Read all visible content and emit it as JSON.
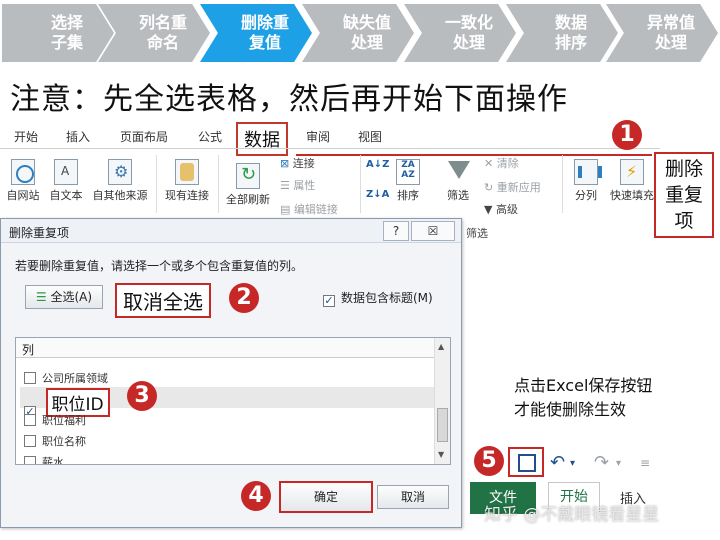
{
  "steps": [
    "选择\n子集",
    "列名重\n命名",
    "删除重\n复值",
    "缺失值\n处理",
    "一致化\n处理",
    "数据\n排序",
    "异常值\n处理"
  ],
  "steps_split": [
    [
      "选择",
      "子集"
    ],
    [
      "列名重",
      "命名"
    ],
    [
      "删除重",
      "复值"
    ],
    [
      "缺失值",
      "处理"
    ],
    [
      "一致化",
      "处理"
    ],
    [
      "数据",
      "排序"
    ],
    [
      "异常值",
      "处理"
    ]
  ],
  "active_step_index": 2,
  "heading": "注意：先全选表格，然后再开始下面操作",
  "ribbon": {
    "tabs": [
      "开始",
      "插入",
      "页面布局",
      "公式",
      "数据",
      "审阅",
      "视图"
    ],
    "active_tab": "数据",
    "buttons": {
      "from_web": "自网站",
      "from_text": "自文本",
      "from_other": "自其他来源",
      "existing_conn": "现有连接",
      "refresh_all": "全部刷新",
      "connections": "连接",
      "properties": "属性",
      "edit_links": "编辑链接",
      "sort": "排序",
      "filter": "筛选",
      "clear": "清除",
      "reapply": "重新应用",
      "advanced": "高级",
      "filter_group": "筛选",
      "split_cols": "分列",
      "flash_fill": "快速填充",
      "remove_dup_callout": [
        "删除",
        "重复",
        "项"
      ]
    }
  },
  "dialog": {
    "title": "删除重复项",
    "help": "?",
    "close": "☒",
    "prompt": "若要删除重复值，请选择一个或多个包含重复值的列。",
    "select_all": "全选(A)",
    "unselect_all_callout": "取消全选",
    "has_header_label": "数据包含标题(M)",
    "list_header": "列",
    "rows": [
      {
        "label": "公司所属领域",
        "checked": false
      },
      {
        "label": "职位ID",
        "checked": true
      },
      {
        "label": "职位福利",
        "checked": false
      },
      {
        "label": "职位名称",
        "checked": false
      },
      {
        "label": "薪水",
        "checked": false
      }
    ],
    "ok": "确定",
    "cancel": "取消"
  },
  "annotations": [
    "1",
    "2",
    "3",
    "4",
    "5"
  ],
  "annotation_1_glyph": "❶",
  "save_note": [
    "点击Excel保存按钮",
    "才能使删除生效"
  ],
  "bottom_tabs": {
    "file": "文件",
    "home": "开始",
    "insert": "插入"
  },
  "watermark": "知乎 @不戴眼镜看星星",
  "colors": {
    "active_step": "#1ea0e6",
    "inactive_step": "#b9bcbf",
    "annotation_red": "#c62828",
    "excel_green": "#217346"
  }
}
